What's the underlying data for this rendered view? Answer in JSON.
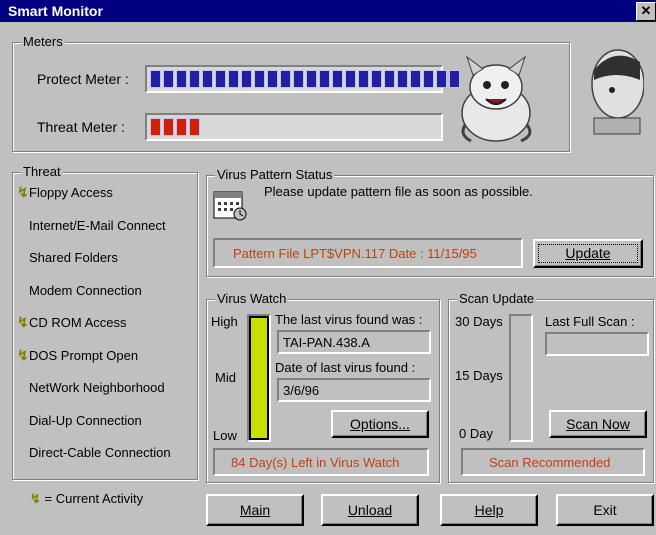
{
  "window": {
    "title": "Smart Monitor",
    "close_glyph": "✕"
  },
  "meters": {
    "group_label": "Meters",
    "protect_label": "Protect Meter :",
    "threat_label": "Threat Meter :",
    "protect_level": 1.0,
    "threat_level": 0.17,
    "protect_color": "#2020a0",
    "threat_color": "#d02000"
  },
  "threat": {
    "group_label": "Threat",
    "items": [
      {
        "label": "Floppy Access",
        "active": true
      },
      {
        "label": "Internet/E-Mail Connect",
        "active": false
      },
      {
        "label": "Shared Folders",
        "active": false
      },
      {
        "label": "Modem Connection",
        "active": false
      },
      {
        "label": "CD ROM Access",
        "active": true
      },
      {
        "label": "DOS Prompt Open",
        "active": true
      },
      {
        "label": "NetWork Neighborhood",
        "active": false
      },
      {
        "label": "Dial-Up Connection",
        "active": false
      },
      {
        "label": "Direct-Cable Connection",
        "active": false
      }
    ],
    "legend": "= Current Activity"
  },
  "pattern": {
    "group_label": "Virus Pattern Status",
    "message": "Please update pattern file as soon as possible.",
    "file_info": "Pattern File LPT$VPN.117 Date : 11/15/95",
    "update_button": "Update"
  },
  "virus_watch": {
    "group_label": "Virus Watch",
    "high": "High",
    "mid": "Mid",
    "low": "Low",
    "level": 1.0,
    "level_color": "#c8e000",
    "last_found_label": "The last virus found was :",
    "last_found_value": "TAI-PAN.438.A",
    "date_label": "Date of last virus found :",
    "date_value": "3/6/96",
    "options_button": "Options...",
    "status": "84 Day(s) Left in Virus Watch"
  },
  "scan_update": {
    "group_label": "Scan Update",
    "days30": "30 Days",
    "days15": "15 Days",
    "days0": "0 Day",
    "last_full_scan_label": "Last Full Scan :",
    "last_full_scan_value": "",
    "scan_now_button": "Scan Now",
    "status": "Scan Recommended"
  },
  "footer": {
    "main_button": "Main",
    "unload_button": "Unload",
    "help_button": "Help",
    "exit_button": "Exit"
  }
}
